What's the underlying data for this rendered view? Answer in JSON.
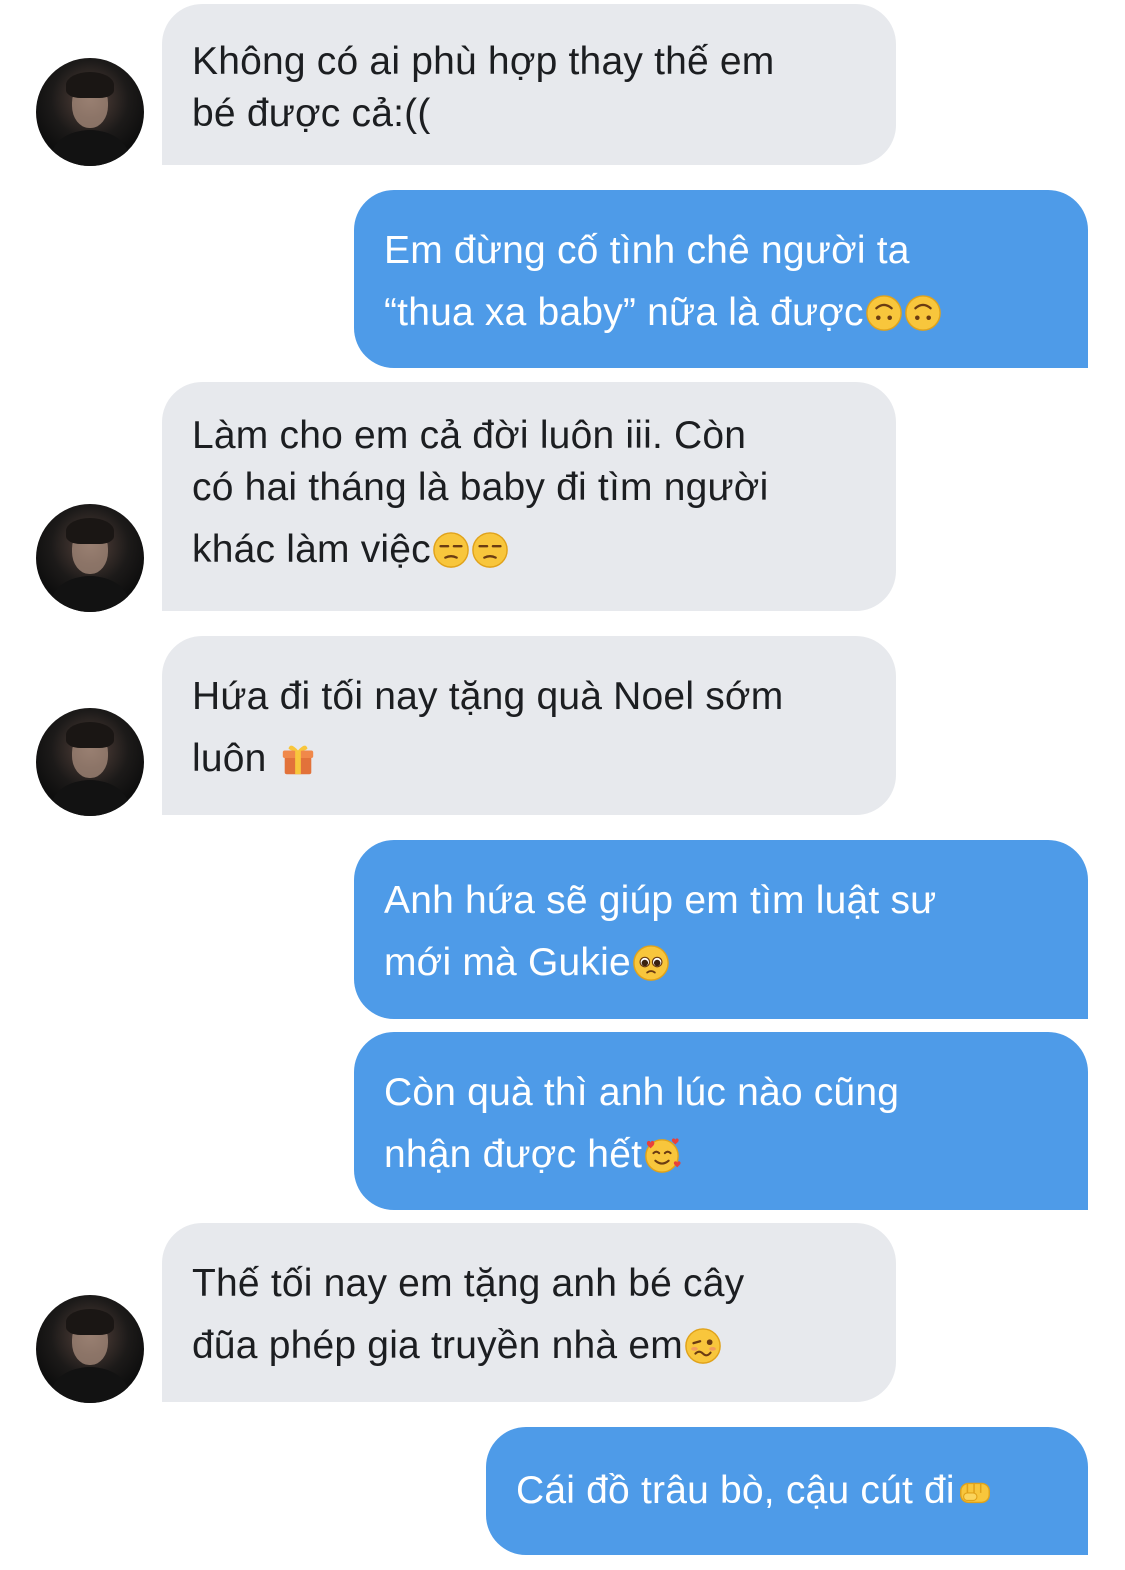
{
  "conversation": {
    "colors": {
      "incoming_bubble": "#e7e9ed",
      "outgoing_bubble": "#4e9be8",
      "incoming_text": "#1c1e21",
      "outgoing_text": "#ffffff"
    },
    "messages": [
      {
        "sender": "contact",
        "lines": [
          "Không có ai phù hợp thay thế em",
          "bé được cả:(("
        ]
      },
      {
        "sender": "me",
        "lines": [
          "Em đừng cố tình chê người ta",
          "“thua xa baby” nữa là được"
        ],
        "emoji": [
          "upside-down-face-emoji",
          "upside-down-face-emoji"
        ]
      },
      {
        "sender": "contact",
        "lines": [
          "Làm cho em cả đời luôn iii. Còn",
          "có hai tháng là baby đi tìm người",
          "khác làm việc"
        ],
        "emoji": [
          "unamused-face-emoji",
          "unamused-face-emoji"
        ]
      },
      {
        "sender": "contact",
        "lines": [
          "Hứa đi tối nay tặng quà Noel sớm",
          "luôn "
        ],
        "emoji": [
          "gift-emoji"
        ]
      },
      {
        "sender": "me",
        "lines": [
          "Anh hứa sẽ giúp em tìm luật sư",
          "mới mà Gukie"
        ],
        "emoji": [
          "pleading-face-emoji"
        ]
      },
      {
        "sender": "me",
        "lines": [
          "Còn quà thì anh lúc nào cũng",
          "nhận được hết"
        ],
        "emoji": [
          "smiling-face-with-hearts-emoji"
        ]
      },
      {
        "sender": "contact",
        "lines": [
          "Thế tối nay em tặng anh bé cây",
          "đũa phép gia truyền nhà em"
        ],
        "emoji": [
          "woozy-face-emoji"
        ]
      },
      {
        "sender": "me",
        "lines": [
          "Cái đồ trâu bò, cậu cút đi"
        ],
        "emoji": [
          "oncoming-fist-emoji"
        ]
      }
    ]
  }
}
